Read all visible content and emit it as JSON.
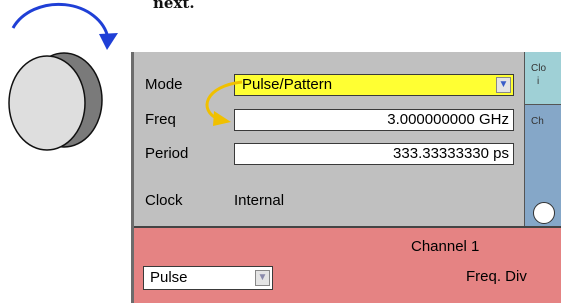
{
  "caption": {
    "text": "next."
  },
  "panel": {
    "mode": {
      "label": "Mode",
      "value": "Pulse/Pattern"
    },
    "freq": {
      "label": "Freq",
      "value": "3.000000000 GHz"
    },
    "period": {
      "label": "Period",
      "value": "333.33333330 ps"
    },
    "clock": {
      "label": "Clock",
      "value": "Internal"
    },
    "side_top": {
      "line1": "Clo",
      "line2": "i"
    },
    "side_mid": {
      "text": "Ch"
    },
    "dropdown_glyph": "▼"
  },
  "channel": {
    "title": "Channel 1",
    "mode_select_value": "Pulse",
    "freq_div_label": "Freq. Div"
  },
  "colors": {
    "mode_highlight": "#ffff33",
    "channel_bg": "#e58383",
    "panel_bg": "#c0c0c0",
    "knob_arrow": "#1f3fd6",
    "annotation_arrow": "#f0c000"
  },
  "icons": [
    "rotary-knob-icon",
    "rotate-arrow-icon",
    "curved-arrow-icon",
    "dropdown-arrow-icon"
  ]
}
